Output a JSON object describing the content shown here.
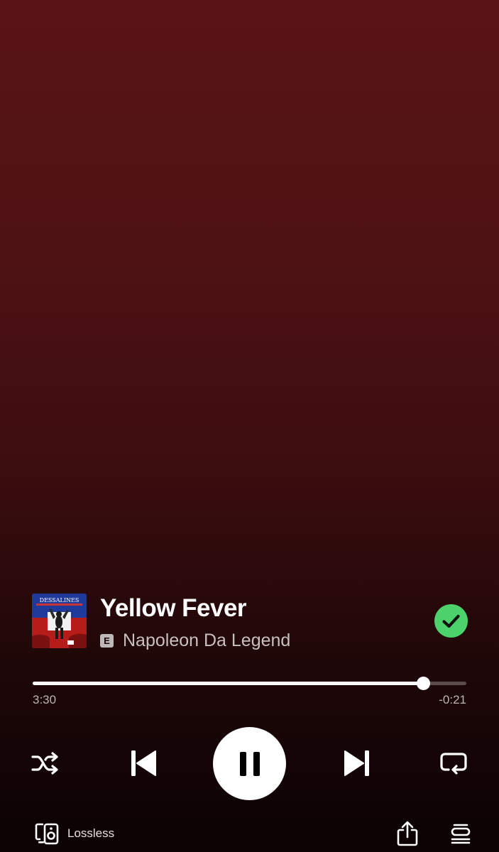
{
  "track": {
    "title": "Yellow Fever",
    "artist": "Napoleon Da Legend",
    "explicit_badge": "E",
    "album_art_text": "DESSALINES",
    "saved": true
  },
  "playback": {
    "elapsed": "3:30",
    "remaining": "-0:21",
    "progress_fraction": 0.9,
    "state": "playing"
  },
  "controls": {
    "shuffle_icon": "shuffle-icon",
    "previous_icon": "skip-previous-icon",
    "pause_icon": "pause-icon",
    "next_icon": "skip-next-icon",
    "repeat_icon": "repeat-icon"
  },
  "footer": {
    "device_label": "Lossless",
    "device_icon": "connect-device-icon",
    "share_icon": "share-icon",
    "queue_icon": "queue-icon"
  },
  "colors": {
    "background_top": "#5a1415",
    "background_bottom": "#0b0203",
    "saved_check": "#4cd26a",
    "progress_fill": "#ffffff"
  }
}
